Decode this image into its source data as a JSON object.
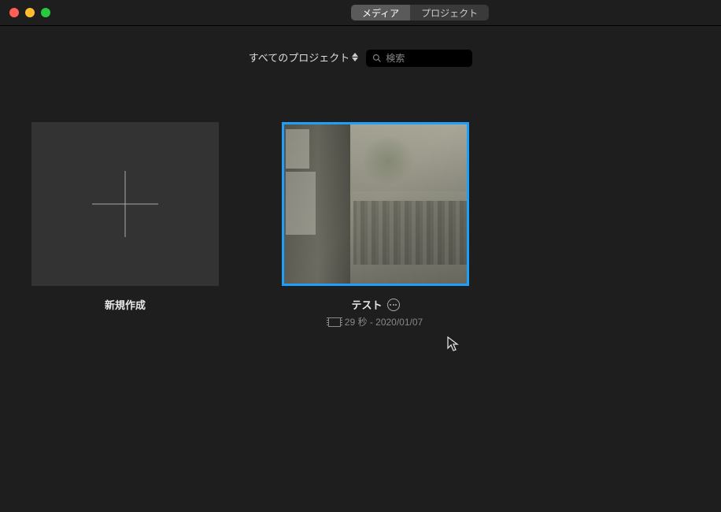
{
  "tabs": {
    "media": "メディア",
    "projects": "プロジェクト"
  },
  "toolbar": {
    "filter_label": "すべてのプロジェクト",
    "search_placeholder": "検索"
  },
  "tiles": {
    "new_label": "新規作成",
    "project": {
      "title": "テスト",
      "meta": "29 秒 - 2020/01/07"
    }
  }
}
